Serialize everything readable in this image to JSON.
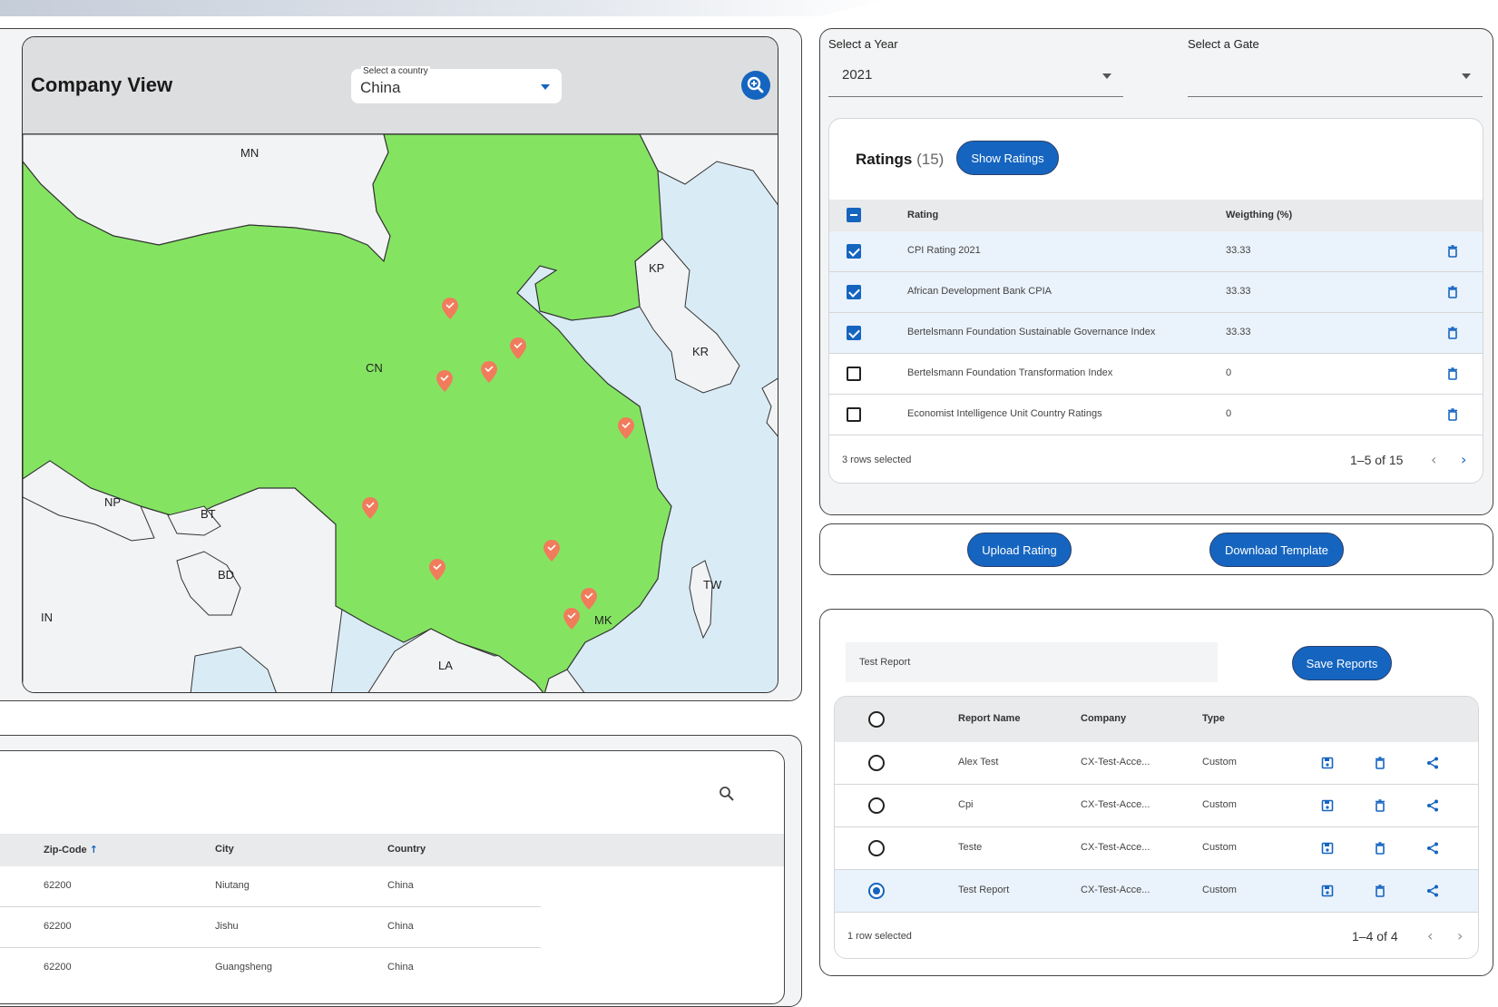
{
  "company_view": {
    "title": "Company View",
    "country_label": "Select a country",
    "country_value": "China",
    "country_labels": [
      "MN",
      "KP",
      "KR",
      "CN",
      "NP",
      "BT",
      "BD",
      "IN",
      "TW",
      "LA",
      "MK"
    ]
  },
  "locations": {
    "columns": [
      "Zip-Code",
      "City",
      "Country"
    ],
    "rows": [
      [
        "62200",
        "Niutang",
        "China"
      ],
      [
        "62200",
        "Jishu",
        "China"
      ],
      [
        "62200",
        "Guangsheng",
        "China"
      ]
    ]
  },
  "filters": {
    "year_label": "Select a Year",
    "year_value": "2021",
    "gate_label": "Select a Gate",
    "gate_value": ""
  },
  "ratings": {
    "title": "Ratings",
    "count": "(15)",
    "show_button": "Show Ratings",
    "columns": [
      "Rating",
      "Weigthing (%)"
    ],
    "rows": [
      {
        "name": "CPI Rating 2021",
        "weight": "33.33",
        "checked": true
      },
      {
        "name": "African Development Bank CPIA",
        "weight": "33.33",
        "checked": true
      },
      {
        "name": "Bertelsmann Foundation Sustainable Governance Index",
        "weight": "33.33",
        "checked": true
      },
      {
        "name": "Bertelsmann Foundation Transformation Index",
        "weight": "0",
        "checked": false
      },
      {
        "name": "Economist Intelligence Unit Country Ratings",
        "weight": "0",
        "checked": false
      }
    ],
    "selected_text": "3 rows selected",
    "pagination": "1–5 of 15"
  },
  "actions": {
    "upload": "Upload Rating",
    "download": "Download Template"
  },
  "reports": {
    "input_value": "Test Report",
    "save_button": "Save Reports",
    "columns": [
      "Report Name",
      "Company",
      "Type"
    ],
    "rows": [
      {
        "name": "Alex Test",
        "company": "CX-Test-Acce...",
        "type": "Custom",
        "selected": false
      },
      {
        "name": "Cpi",
        "company": "CX-Test-Acce...",
        "type": "Custom",
        "selected": false
      },
      {
        "name": "Teste",
        "company": "CX-Test-Acce...",
        "type": "Custom",
        "selected": false
      },
      {
        "name": "Test Report",
        "company": "CX-Test-Acce...",
        "type": "Custom",
        "selected": true
      }
    ],
    "selected_text": "1 row selected",
    "pagination": "1–4 of 4"
  },
  "colors": {
    "accent": "#1565c0",
    "land_selected": "#84e462",
    "land_other": "#f2f3f4",
    "sea": "#d9ebf5",
    "marker": "#f07c5c"
  },
  "icons": [
    "zoom-in-icon",
    "search-icon",
    "trash-icon",
    "save-icon",
    "share-icon",
    "chevron-left-icon",
    "chevron-right-icon",
    "dropdown-caret-icon",
    "map-marker-icon"
  ]
}
